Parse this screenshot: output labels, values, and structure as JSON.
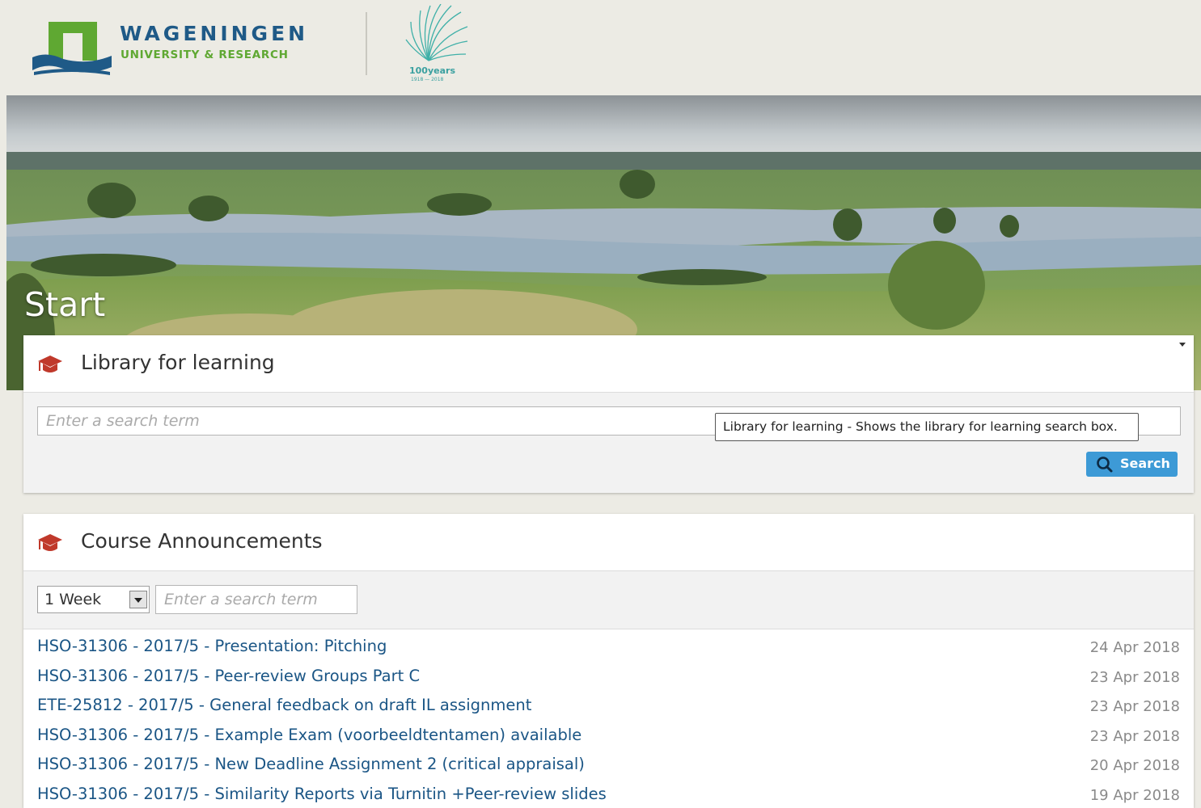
{
  "header": {
    "brand_name": "WAGENINGEN",
    "brand_sub": "UNIVERSITY & RESEARCH",
    "anniversary_title": "100years",
    "anniversary_range": "1918 — 2018"
  },
  "page": {
    "title": "Start"
  },
  "library": {
    "title": "Library for learning",
    "search_placeholder": "Enter a search term",
    "search_button": "Search",
    "tooltip": "Library for learning - Shows the library for learning search box."
  },
  "announcements": {
    "title": "Course Announcements",
    "period_selected": "1 Week",
    "search_placeholder": "Enter a search term",
    "items": [
      {
        "title": "HSO-31306 - 2017/5 - Presentation: Pitching",
        "date": "24 Apr 2018"
      },
      {
        "title": "HSO-31306 - 2017/5 - Peer-review Groups Part C",
        "date": "23 Apr 2018"
      },
      {
        "title": "ETE-25812 - 2017/5 - General feedback on draft IL assignment",
        "date": "23 Apr 2018"
      },
      {
        "title": "HSO-31306 - 2017/5 - Example Exam (voorbeeldtentamen) available",
        "date": "23 Apr 2018"
      },
      {
        "title": "HSO-31306 - 2017/5 - New Deadline Assignment 2 (critical appraisal)",
        "date": "20 Apr 2018"
      },
      {
        "title": "HSO-31306 - 2017/5 - Similarity Reports via Turnitin +Peer-review slides",
        "date": "19 Apr 2018"
      }
    ]
  },
  "colors": {
    "brand_blue": "#1f5a87",
    "brand_green": "#5fa832",
    "accent_red": "#c0392b",
    "link": "#1a5585",
    "button": "#3d9ad6"
  },
  "icons": {
    "portlet_icon": "graduation-cap-icon",
    "search_icon": "magnifier-icon"
  }
}
